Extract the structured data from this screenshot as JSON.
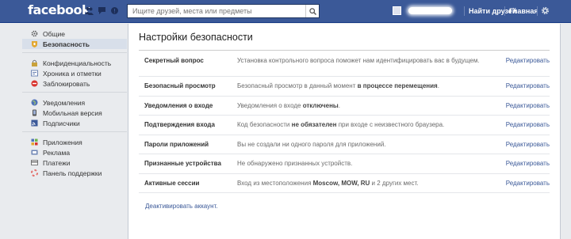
{
  "header": {
    "logo": "facebook",
    "search_placeholder": "Ищите друзей, места или предметы",
    "find_friends": "Найти друзей",
    "home": "Главная"
  },
  "sidebar": {
    "groups": [
      [
        "Общие",
        "Безопасность"
      ],
      [
        "Конфиденциальность",
        "Хроника и отметки",
        "Заблокировать"
      ],
      [
        "Уведомления",
        "Мобильная версия",
        "Подписчики"
      ],
      [
        "Приложения",
        "Реклама",
        "Платежи",
        "Панель поддержки"
      ]
    ],
    "active": "Безопасность"
  },
  "main": {
    "title": "Настройки безопасности",
    "edit_label": "Редактировать",
    "rows": [
      {
        "label": "Секретный вопрос",
        "desc": "Установка контрольного вопроса поможет нам идентифицировать вас в будущем."
      },
      {
        "label": "Безопасный просмотр",
        "desc_pre": "Безопасный просмотр в данный момент ",
        "desc_bold": "в процессе перемещения",
        "desc_post": "."
      },
      {
        "label": "Уведомления о входе",
        "desc_pre": "Уведомления о входе ",
        "desc_bold": "отключены",
        "desc_post": "."
      },
      {
        "label": "Подтверждения входа",
        "desc_pre": "Код безопасности ",
        "desc_bold": "не обязателен",
        "desc_post": " при входе с неизвестного браузера."
      },
      {
        "label": "Пароли приложений",
        "desc": "Вы не создали ни одного пароля для приложений."
      },
      {
        "label": "Признанные устройства",
        "desc": "Не обнаружено признанных устройств."
      },
      {
        "label": "Активные сессии",
        "desc_pre": "Вход из местоположения ",
        "desc_bold": "Moscow, MOW, RU",
        "desc_post": " и 2 других мест."
      }
    ],
    "deactivate": "Деактивировать аккаунт."
  },
  "colors": {
    "brand_blue": "#3b5998",
    "active_item": "#d8dfea",
    "page_bg": "#e9ebee"
  }
}
